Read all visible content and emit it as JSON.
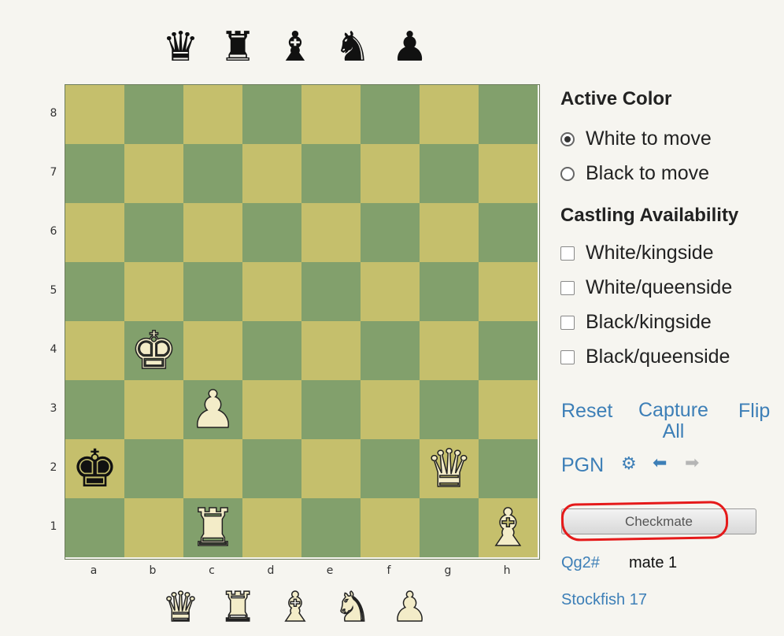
{
  "captured_black": [
    {
      "name": "black-queen",
      "glyph": "♛"
    },
    {
      "name": "black-rook",
      "glyph": "♜"
    },
    {
      "name": "black-bishop",
      "glyph": "♝"
    },
    {
      "name": "black-knight",
      "glyph": "♞"
    },
    {
      "name": "black-pawn",
      "glyph": "♟"
    }
  ],
  "captured_white": [
    {
      "name": "white-queen",
      "glyph": "♛"
    },
    {
      "name": "white-rook",
      "glyph": "♜"
    },
    {
      "name": "white-bishop",
      "glyph": "♝"
    },
    {
      "name": "white-knight",
      "glyph": "♞"
    },
    {
      "name": "white-pawn",
      "glyph": "♟"
    }
  ],
  "board": {
    "ranks": [
      "8",
      "7",
      "6",
      "5",
      "4",
      "3",
      "2",
      "1"
    ],
    "files": [
      "a",
      "b",
      "c",
      "d",
      "e",
      "f",
      "g",
      "h"
    ],
    "pieces": [
      {
        "square": "b4",
        "color": "white",
        "type": "king",
        "glyph": "♚"
      },
      {
        "square": "c3",
        "color": "white",
        "type": "pawn",
        "glyph": "♟"
      },
      {
        "square": "a2",
        "color": "black",
        "type": "king",
        "glyph": "♚"
      },
      {
        "square": "g2",
        "color": "white",
        "type": "queen",
        "glyph": "♛"
      },
      {
        "square": "c1",
        "color": "white",
        "type": "rook",
        "glyph": "♜"
      },
      {
        "square": "h1",
        "color": "white",
        "type": "bishop",
        "glyph": "♝"
      }
    ],
    "light_color": "#c5bf6c",
    "dark_color": "#82a06c"
  },
  "active_color": {
    "title": "Active Color",
    "options": [
      {
        "label": "White to move",
        "checked": true
      },
      {
        "label": "Black to move",
        "checked": false
      }
    ]
  },
  "castling": {
    "title": "Castling Availability",
    "options": [
      {
        "label": "White/kingside",
        "checked": false
      },
      {
        "label": "White/queenside",
        "checked": false
      },
      {
        "label": "Black/kingside",
        "checked": false
      },
      {
        "label": "Black/queenside",
        "checked": false
      }
    ]
  },
  "actions": {
    "reset": "Reset",
    "capture_all_line1": "Capture",
    "capture_all_line2": "All",
    "flip": "Flip",
    "pgn": "PGN",
    "settings_icon": "gear-icon",
    "back_icon": "arrow-left-icon",
    "forward_icon": "arrow-right-icon"
  },
  "status": {
    "button_label": "Checkmate",
    "move": "Qg2#",
    "eval": "mate 1",
    "engine": "Stockfish 17"
  },
  "accent_color": "#3d7fb7",
  "highlight_color": "#e51a1a"
}
